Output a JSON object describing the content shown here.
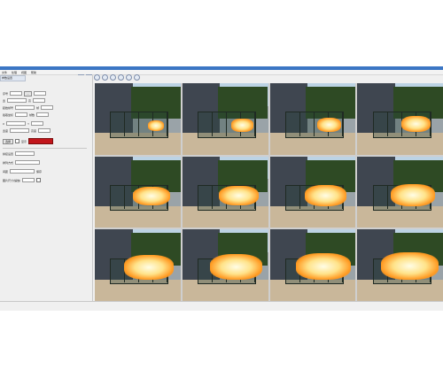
{
  "menu": {
    "items": [
      "文件",
      "处理",
      "视图",
      "帮助"
    ]
  },
  "panel": {
    "tab": "参数设置",
    "rows": [
      {
        "label": "序号",
        "value": "3"
      },
      {
        "label": "宽",
        "value": "",
        "label2": "高",
        "value2": ""
      },
      {
        "label": "起始帧号",
        "value": "",
        "label2": "帧",
        "value2": ""
      },
      {
        "label": "截取坐标",
        "value": "",
        "label2": "帧数",
        "value2": ""
      },
      {
        "label": "X",
        "value": "",
        "label2": "Y",
        "value2": ""
      },
      {
        "label": "宽度",
        "value": "",
        "label2": "高度",
        "value2": ""
      }
    ],
    "apply_button": "选择",
    "checkbox_label": "显示",
    "group_label": "拼接设置",
    "sub_labels": [
      "排列方式",
      "间距",
      "图片尺寸(缩放)"
    ],
    "save_label": "保存",
    "color_accent": "#c2151b"
  },
  "status": {
    "text": ""
  }
}
